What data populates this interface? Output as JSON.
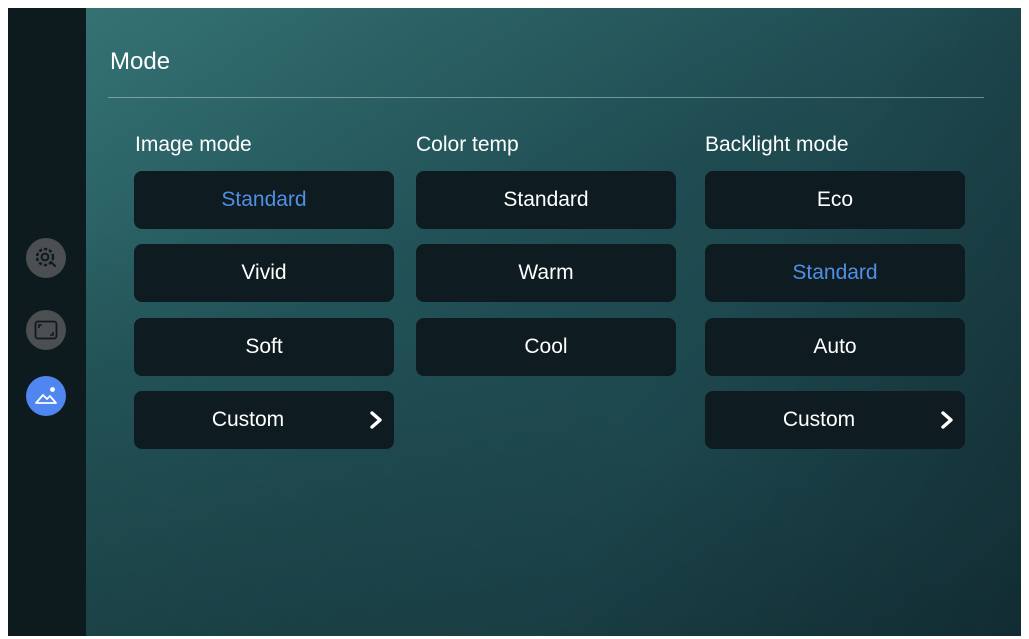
{
  "title": "Mode",
  "sidebar": {
    "items": [
      {
        "name": "settings-icon",
        "active": false
      },
      {
        "name": "display-ratio-icon",
        "active": false
      },
      {
        "name": "image-mode-icon",
        "active": true
      }
    ]
  },
  "columns": {
    "image_mode": {
      "header": "Image mode",
      "options": [
        "Standard",
        "Vivid",
        "Soft",
        "Custom"
      ],
      "selected": "Standard"
    },
    "color_temp": {
      "header": "Color temp",
      "options": [
        "Standard",
        "Warm",
        "Cool"
      ],
      "selected": "Standard"
    },
    "backlight_mode": {
      "header": "Backlight mode",
      "options": [
        "Eco",
        "Standard",
        "Auto",
        "Custom"
      ],
      "selected": "Standard"
    }
  },
  "colors": {
    "selected_text": "#4f8fe6",
    "active_sidebar": "#4f86f0",
    "button_bg": "#0e1b20"
  }
}
